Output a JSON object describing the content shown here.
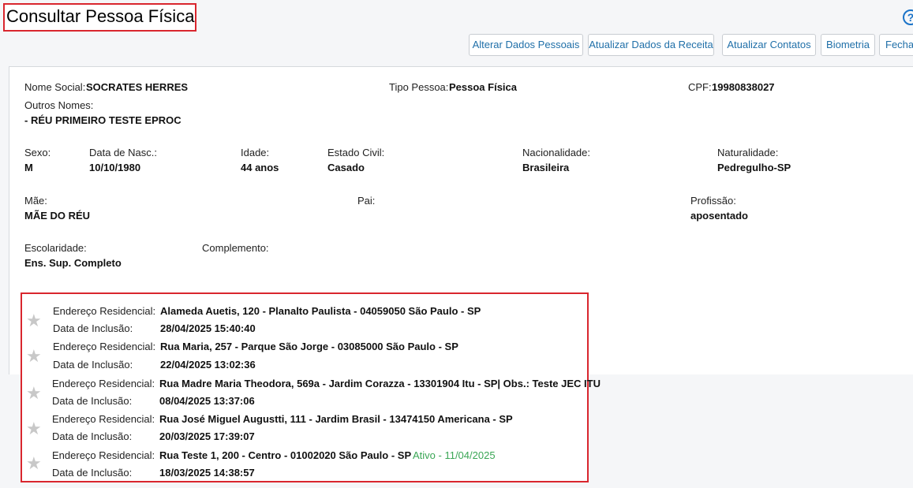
{
  "page": {
    "title": "Consultar Pessoa Física",
    "help_icon": "?"
  },
  "toolbar": {
    "buttons": [
      {
        "label": "Alterar Dados Pessoais"
      },
      {
        "label": "Atualizar Dados da Receita"
      },
      {
        "label": "Atualizar Contatos"
      },
      {
        "label": "Biometria"
      },
      {
        "label": "Fechar"
      }
    ]
  },
  "person": {
    "nome_social_label": "Nome Social:",
    "nome_social": "SOCRATES HERRES",
    "tipo_pessoa_label": "Tipo Pessoa:",
    "tipo_pessoa": "Pessoa Física",
    "cpf_label": "CPF:",
    "cpf": "19980838027",
    "outros_nomes_label": "Outros Nomes:",
    "outros_nomes": "- RÉU PRIMEIRO TESTE EPROC",
    "sexo_label": "Sexo:",
    "sexo": "M",
    "data_nasc_label": "Data de Nasc.:",
    "data_nasc": "10/10/1980",
    "idade_label": "Idade:",
    "idade": "44 anos",
    "estado_civil_label": "Estado Civil:",
    "estado_civil": "Casado",
    "nacionalidade_label": "Nacionalidade:",
    "nacionalidade": "Brasileira",
    "naturalidade_label": "Naturalidade:",
    "naturalidade": "Pedregulho-SP",
    "mae_label": "Mãe:",
    "mae": "MÃE DO RÉU",
    "pai_label": "Pai:",
    "profissao_label": "Profissão:",
    "profissao": "aposentado",
    "escolaridade_label": "Escolaridade:",
    "escolaridade": "Ens. Sup. Completo",
    "complemento_label": "Complemento:"
  },
  "addresses": {
    "address_label": "Endereço Residencial:",
    "date_label": "Data de Inclusão:",
    "status_color": "#3aa655",
    "items": [
      {
        "address": "Alameda Auetis, 120 - Planalto Paulista - 04059050   São Paulo - SP",
        "status": "",
        "date": "28/04/2025 15:40:40"
      },
      {
        "address": "Rua Maria, 257 - Parque São Jorge - 03085000   São Paulo - SP",
        "status": "",
        "date": "22/04/2025 13:02:36"
      },
      {
        "address": "Rua Madre Maria Theodora, 569a - Jardim Corazza - 13301904   Itu - SP| Obs.: Teste JEC ITU",
        "status": "",
        "date": "08/04/2025 13:37:06"
      },
      {
        "address": "Rua José Miguel Augustti, 111 - Jardim Brasil - 13474150   Americana - SP",
        "status": "",
        "date": "20/03/2025 17:39:07"
      },
      {
        "address": "Rua Teste 1, 200 - Centro - 01002020   São Paulo - SP",
        "status": "Ativo - 11/04/2025",
        "date": "18/03/2025 14:38:57"
      }
    ]
  }
}
